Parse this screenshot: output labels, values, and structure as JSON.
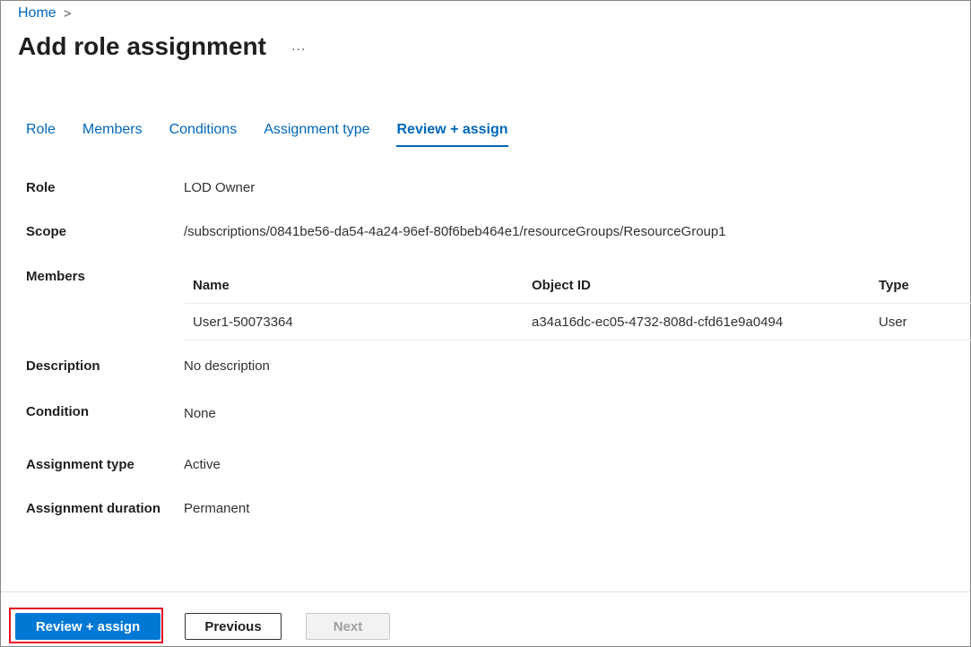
{
  "breadcrumb": {
    "home": "Home",
    "separator": ">"
  },
  "header": {
    "title": "Add role assignment",
    "more": "..."
  },
  "tabs": [
    {
      "label": "Role"
    },
    {
      "label": "Members"
    },
    {
      "label": "Conditions"
    },
    {
      "label": "Assignment type"
    },
    {
      "label": "Review + assign",
      "active": true
    }
  ],
  "details": {
    "role": {
      "label": "Role",
      "value": "LOD Owner"
    },
    "scope": {
      "label": "Scope",
      "value": "/subscriptions/0841be56-da54-4a24-96ef-80f6beb464e1/resourceGroups/ResourceGroup1"
    },
    "members": {
      "label": "Members",
      "columns": [
        "Name",
        "Object ID",
        "Type"
      ],
      "rows": [
        {
          "name": "User1-50073364",
          "object_id": "a34a16dc-ec05-4732-808d-cfd61e9a0494",
          "type": "User"
        }
      ]
    },
    "description": {
      "label": "Description",
      "value": "No description"
    },
    "condition": {
      "label": "Condition",
      "value": "None"
    },
    "assignment_type": {
      "label": "Assignment type",
      "value": "Active"
    },
    "assignment_duration": {
      "label": "Assignment duration",
      "value": "Permanent"
    }
  },
  "footer": {
    "review_assign_label": "Review + assign",
    "previous_label": "Previous",
    "next_label": "Next",
    "highlight_color": "#e81123",
    "primary_color": "#0078d4"
  }
}
